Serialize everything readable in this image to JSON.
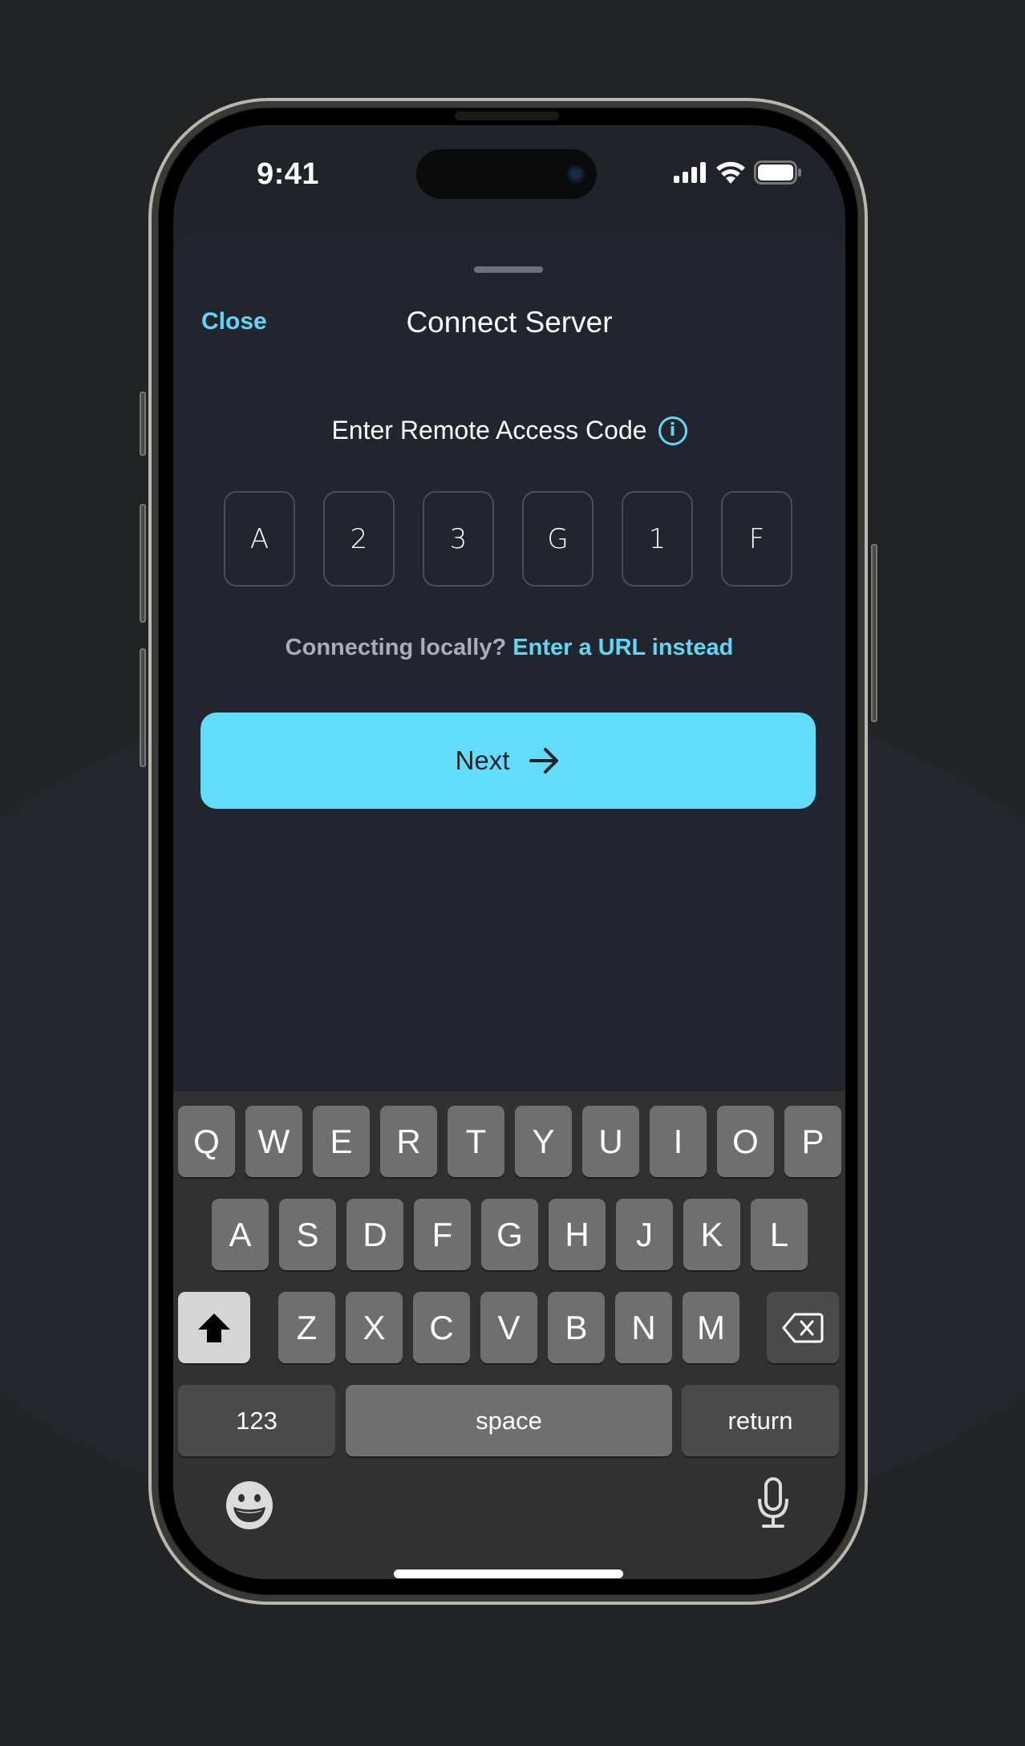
{
  "status_bar": {
    "time": "9:41",
    "icons": [
      "cellular-signal-icon",
      "wifi-icon",
      "battery-icon"
    ]
  },
  "sheet": {
    "close_label": "Close",
    "title": "Connect Server"
  },
  "code_entry": {
    "label": "Enter Remote Access Code",
    "info_icon_glyph": "i",
    "digits": [
      "A",
      "2",
      "3",
      "G",
      "1",
      "F"
    ]
  },
  "local_prompt": {
    "question": "Connecting locally?",
    "link": "Enter a URL instead"
  },
  "next_button": {
    "label": "Next",
    "icon": "arrow-right-icon"
  },
  "keyboard": {
    "row1": [
      "Q",
      "W",
      "E",
      "R",
      "T",
      "Y",
      "U",
      "I",
      "O",
      "P"
    ],
    "row2": [
      "A",
      "S",
      "D",
      "F",
      "G",
      "H",
      "J",
      "K",
      "L"
    ],
    "row3": [
      "Z",
      "X",
      "C",
      "V",
      "B",
      "N",
      "M"
    ],
    "numbers_label": "123",
    "space_label": "space",
    "return_label": "return",
    "shift_active": true
  },
  "colors": {
    "accent": "#5fd7f5",
    "button": "#63dcf9",
    "sheet_bg": "#22252d",
    "keyboard_bg": "#313131"
  }
}
